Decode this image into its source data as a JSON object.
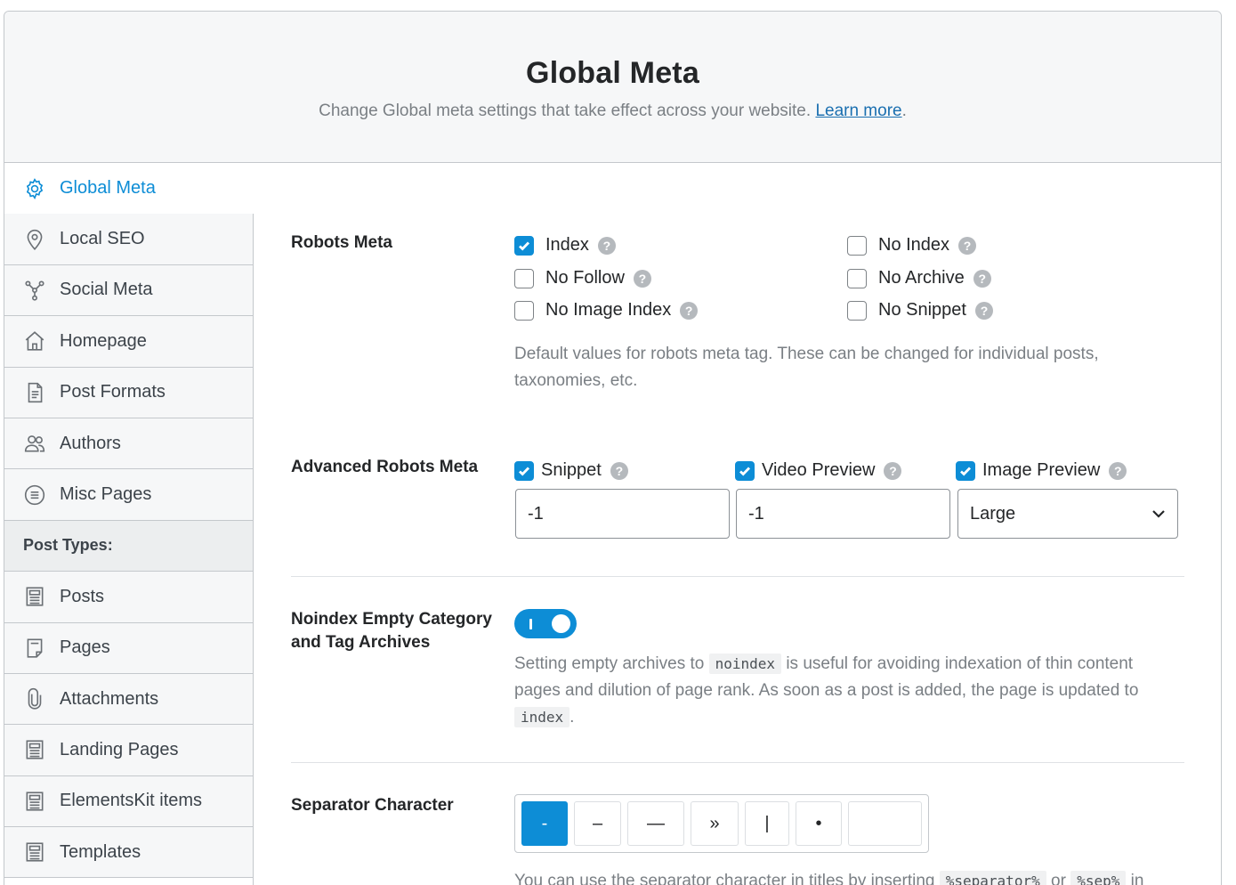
{
  "header": {
    "title": "Global Meta",
    "subtitle": "Change Global meta settings that take effect across your website.",
    "learn_more": "Learn more",
    "period": "."
  },
  "sidebar": {
    "items": [
      {
        "label": "Global Meta",
        "icon": "gear-icon"
      },
      {
        "label": "Local SEO",
        "icon": "map-pin-icon"
      },
      {
        "label": "Social Meta",
        "icon": "share-icon"
      },
      {
        "label": "Homepage",
        "icon": "home-icon"
      },
      {
        "label": "Post Formats",
        "icon": "document-icon"
      },
      {
        "label": "Authors",
        "icon": "users-icon"
      },
      {
        "label": "Misc Pages",
        "icon": "list-circle-icon"
      },
      {
        "label": "Post Types:",
        "icon": ""
      },
      {
        "label": "Posts",
        "icon": "post-icon"
      },
      {
        "label": "Pages",
        "icon": "page-icon"
      },
      {
        "label": "Attachments",
        "icon": "paperclip-icon"
      },
      {
        "label": "Landing Pages",
        "icon": "post-icon"
      },
      {
        "label": "ElementsKit items",
        "icon": "post-icon"
      },
      {
        "label": "Templates",
        "icon": "post-icon"
      }
    ]
  },
  "robots_meta": {
    "label": "Robots Meta",
    "options": [
      {
        "label": "Index",
        "checked": true
      },
      {
        "label": "No Index",
        "checked": false
      },
      {
        "label": "No Follow",
        "checked": false
      },
      {
        "label": "No Archive",
        "checked": false
      },
      {
        "label": "No Image Index",
        "checked": false
      },
      {
        "label": "No Snippet",
        "checked": false
      }
    ],
    "help": "?",
    "description_line1": "Default values for robots meta tag. These can be changed for individual posts,",
    "description_line2": "taxonomies, etc."
  },
  "advanced_robots": {
    "label": "Advanced Robots Meta",
    "snippet": {
      "label": "Snippet",
      "checked": true,
      "value": "-1"
    },
    "video_preview": {
      "label": "Video Preview",
      "checked": true,
      "value": "-1"
    },
    "image_preview": {
      "label": "Image Preview",
      "checked": true,
      "value": "Large"
    }
  },
  "noindex_empty": {
    "label_line1": "Noindex Empty Category",
    "label_line2": "and Tag Archives",
    "enabled": true,
    "desc_pre": "Setting empty archives to",
    "desc_code1": "noindex",
    "desc_mid": "is useful for avoiding indexation of thin content",
    "desc_line2": "pages and dilution of page rank. As soon as a post is added, the page is updated to",
    "desc_code2": "index",
    "desc_end": "."
  },
  "separator": {
    "label": "Separator Character",
    "options": [
      "-",
      "–",
      "—",
      "»",
      "|",
      "•",
      ""
    ],
    "selected_index": 0,
    "desc_pre": "You can use the separator character in titles by inserting",
    "desc_code1": "%separator%",
    "desc_or": "or",
    "desc_code2": "%sep%",
    "desc_end": "in"
  },
  "colors": {
    "accent": "#0d8dd6",
    "help_bg": "#b5b9bd",
    "muted_text": "#7a7f84"
  }
}
